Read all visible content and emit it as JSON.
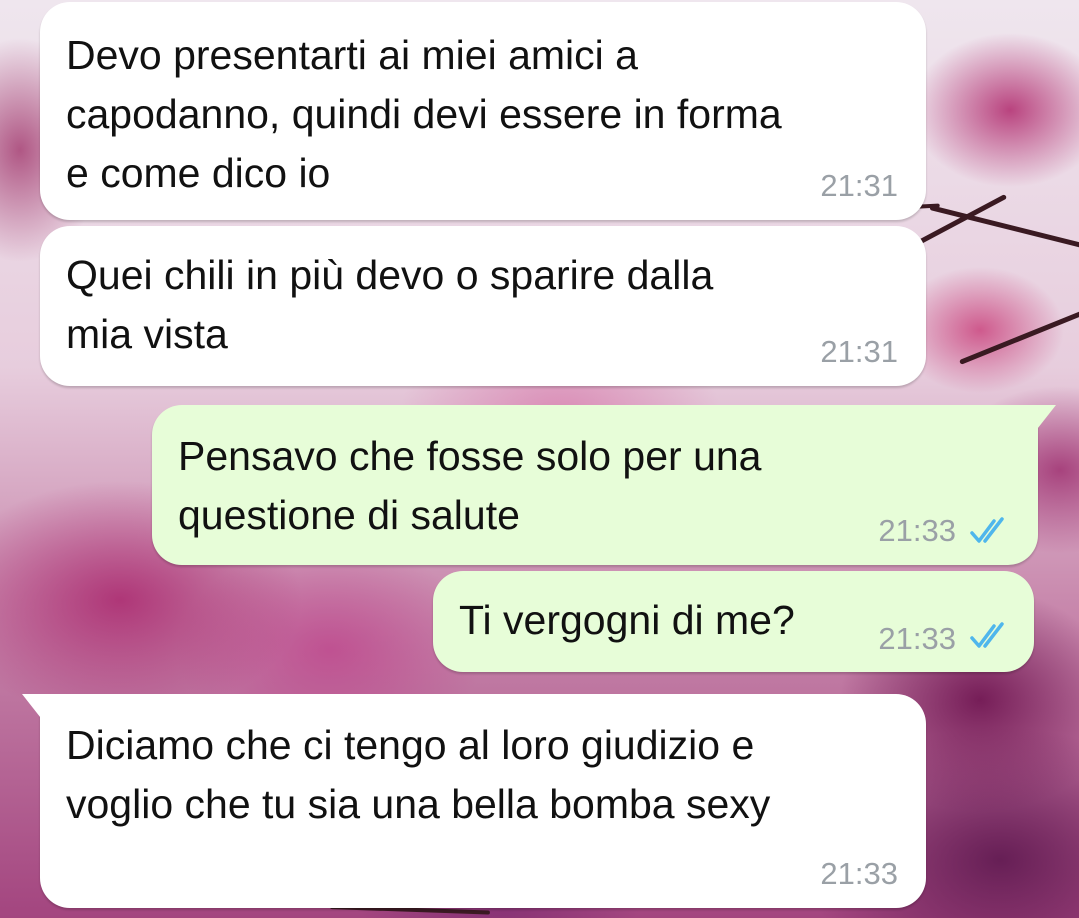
{
  "messages": [
    {
      "direction": "incoming",
      "text": "Devo presentarti ai miei amici a\ncapodanno, quindi devi essere in forma\ne come dico io",
      "time": "21:31"
    },
    {
      "direction": "incoming",
      "text": "Quei chili in più devo o sparire dalla\nmia vista",
      "time": "21:31"
    },
    {
      "direction": "outgoing",
      "text": "Pensavo che fosse solo per una\nquestione di salute",
      "time": "21:33",
      "status": "read-double-check-icon"
    },
    {
      "direction": "outgoing",
      "text": "Ti vergogni di me?",
      "time": "21:33",
      "status": "read-double-check-icon"
    },
    {
      "direction": "incoming",
      "text": "Diciamo che ci tengo al loro giudizio e\nvoglio che tu sia una bella bomba sexy",
      "time": "21:33"
    }
  ],
  "colors": {
    "incoming_bubble": "#ffffff",
    "outgoing_bubble": "#e7fdd8",
    "timestamp": "#9aa0a6",
    "read_check": "#4fb6ec"
  },
  "wallpaper": "pink-magnolia-blossoms"
}
